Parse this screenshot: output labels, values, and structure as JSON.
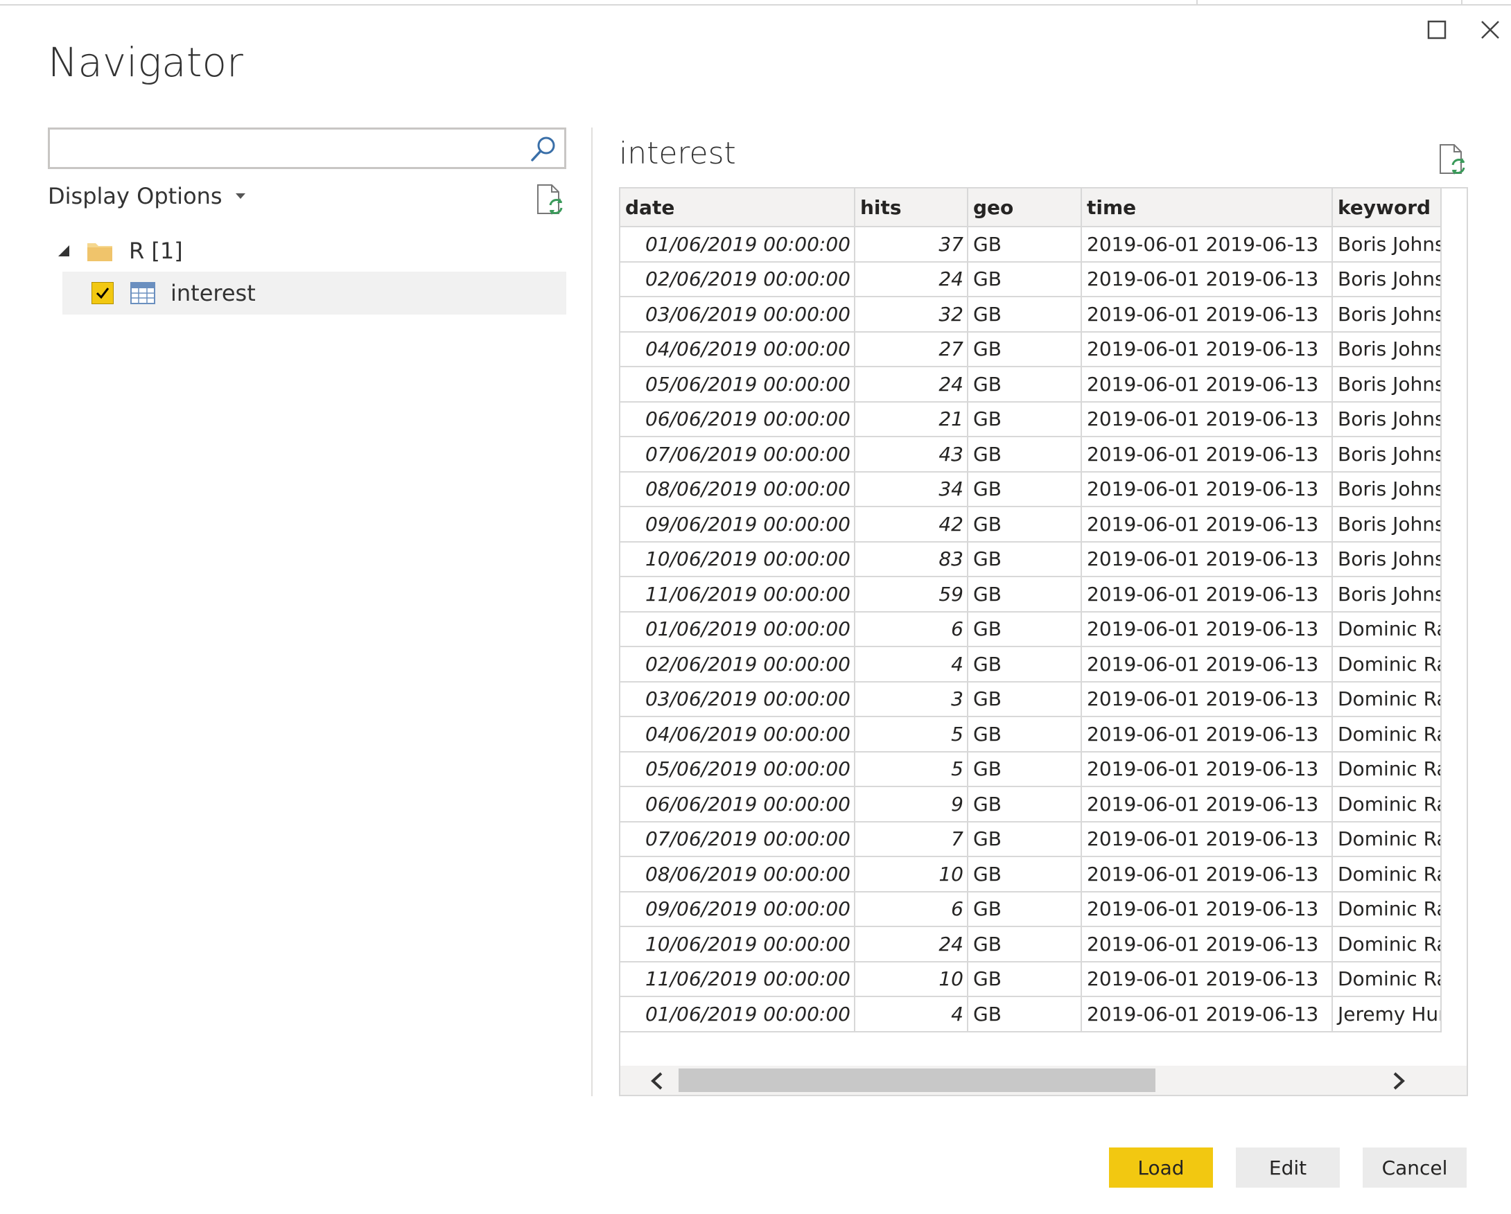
{
  "dialog": {
    "title": "Navigator",
    "search": {
      "value": "",
      "placeholder": ""
    },
    "display_options_label": "Display Options"
  },
  "tree": {
    "root_label": "R [1]",
    "items": [
      {
        "label": "interest",
        "checked": true
      }
    ]
  },
  "preview": {
    "title": "interest",
    "columns": [
      "date",
      "hits",
      "geo",
      "time",
      "keyword"
    ],
    "rows": [
      [
        "01/06/2019 00:00:00",
        "37",
        "GB",
        "2019-06-01 2019-06-13",
        "Boris Johnsc"
      ],
      [
        "02/06/2019 00:00:00",
        "24",
        "GB",
        "2019-06-01 2019-06-13",
        "Boris Johnsc"
      ],
      [
        "03/06/2019 00:00:00",
        "32",
        "GB",
        "2019-06-01 2019-06-13",
        "Boris Johnsc"
      ],
      [
        "04/06/2019 00:00:00",
        "27",
        "GB",
        "2019-06-01 2019-06-13",
        "Boris Johnsc"
      ],
      [
        "05/06/2019 00:00:00",
        "24",
        "GB",
        "2019-06-01 2019-06-13",
        "Boris Johnsc"
      ],
      [
        "06/06/2019 00:00:00",
        "21",
        "GB",
        "2019-06-01 2019-06-13",
        "Boris Johnsc"
      ],
      [
        "07/06/2019 00:00:00",
        "43",
        "GB",
        "2019-06-01 2019-06-13",
        "Boris Johnsc"
      ],
      [
        "08/06/2019 00:00:00",
        "34",
        "GB",
        "2019-06-01 2019-06-13",
        "Boris Johnsc"
      ],
      [
        "09/06/2019 00:00:00",
        "42",
        "GB",
        "2019-06-01 2019-06-13",
        "Boris Johnsc"
      ],
      [
        "10/06/2019 00:00:00",
        "83",
        "GB",
        "2019-06-01 2019-06-13",
        "Boris Johnsc"
      ],
      [
        "11/06/2019 00:00:00",
        "59",
        "GB",
        "2019-06-01 2019-06-13",
        "Boris Johnsc"
      ],
      [
        "01/06/2019 00:00:00",
        "6",
        "GB",
        "2019-06-01 2019-06-13",
        "Dominic Raa"
      ],
      [
        "02/06/2019 00:00:00",
        "4",
        "GB",
        "2019-06-01 2019-06-13",
        "Dominic Raa"
      ],
      [
        "03/06/2019 00:00:00",
        "3",
        "GB",
        "2019-06-01 2019-06-13",
        "Dominic Raa"
      ],
      [
        "04/06/2019 00:00:00",
        "5",
        "GB",
        "2019-06-01 2019-06-13",
        "Dominic Raa"
      ],
      [
        "05/06/2019 00:00:00",
        "5",
        "GB",
        "2019-06-01 2019-06-13",
        "Dominic Raa"
      ],
      [
        "06/06/2019 00:00:00",
        "9",
        "GB",
        "2019-06-01 2019-06-13",
        "Dominic Raa"
      ],
      [
        "07/06/2019 00:00:00",
        "7",
        "GB",
        "2019-06-01 2019-06-13",
        "Dominic Raa"
      ],
      [
        "08/06/2019 00:00:00",
        "10",
        "GB",
        "2019-06-01 2019-06-13",
        "Dominic Raa"
      ],
      [
        "09/06/2019 00:00:00",
        "6",
        "GB",
        "2019-06-01 2019-06-13",
        "Dominic Raa"
      ],
      [
        "10/06/2019 00:00:00",
        "24",
        "GB",
        "2019-06-01 2019-06-13",
        "Dominic Raa"
      ],
      [
        "11/06/2019 00:00:00",
        "10",
        "GB",
        "2019-06-01 2019-06-13",
        "Dominic Raa"
      ],
      [
        "01/06/2019 00:00:00",
        "4",
        "GB",
        "2019-06-01 2019-06-13",
        "Jeremy Hunt"
      ]
    ]
  },
  "buttons": {
    "load": "Load",
    "edit": "Edit",
    "cancel": "Cancel"
  },
  "colors": {
    "accent": "#f2c811",
    "grid_border": "#d8d8d8",
    "header_bg": "#f3f2f1",
    "scroll_thumb": "#c8c8c8"
  },
  "icons": {
    "maximize": "maximize-icon",
    "close": "close-icon",
    "search": "search-icon",
    "dropdown": "caret-down-icon",
    "refresh": "refresh-document-icon",
    "folder": "folder-icon",
    "table": "table-icon",
    "check": "checkmark-icon"
  }
}
